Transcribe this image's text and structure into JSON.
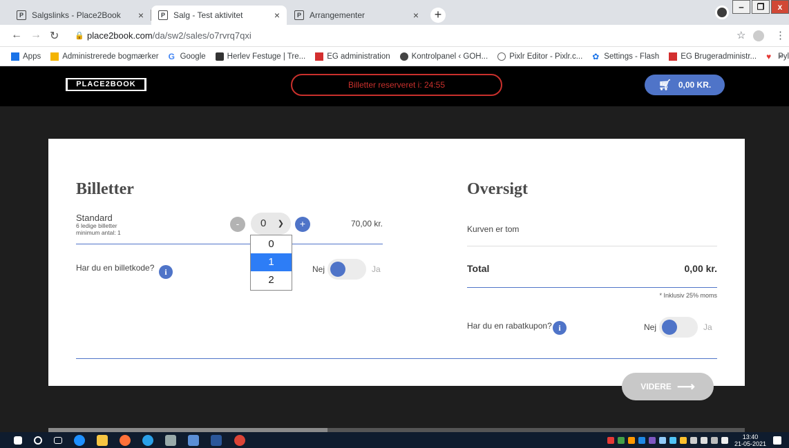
{
  "browser": {
    "tabs": [
      {
        "title": "Salgslinks - Place2Book",
        "active": false
      },
      {
        "title": "Salg - Test aktivitet",
        "active": true
      },
      {
        "title": "Arrangementer",
        "active": false
      }
    ],
    "new_tab": "+",
    "window_controls": {
      "minimize": "‒",
      "restore": "❐",
      "close": "x"
    },
    "url_host": "place2book.com",
    "url_path": "/da/sw2/sales/o7rvrq7qxi",
    "bookmarks": [
      {
        "label": "Apps",
        "icon": "apps-grid-icon",
        "color": "#1a73e8"
      },
      {
        "label": "Administrerede bogmærker",
        "icon": "folder-icon",
        "color": "#f4b400"
      },
      {
        "label": "Google",
        "icon": "google-icon",
        "color": "#4285f4"
      },
      {
        "label": "Herlev Festuge | Tre...",
        "icon": "trello-icon",
        "color": "#333333"
      },
      {
        "label": "EG administration",
        "icon": "eg-icon",
        "color": "#d32f2f"
      },
      {
        "label": "Kontrolpanel ‹ GOH...",
        "icon": "wordpress-icon",
        "color": "#444444"
      },
      {
        "label": "Pixlr Editor - Pixlr.c...",
        "icon": "pixlr-icon",
        "color": "#666666"
      },
      {
        "label": "Settings - Flash",
        "icon": "gear-icon",
        "color": "#1a73e8"
      },
      {
        "label": "EG Brugeradministr...",
        "icon": "eg-icon",
        "color": "#d32f2f"
      },
      {
        "label": "Pylon",
        "icon": "pylon-icon",
        "color": "#e53935"
      }
    ],
    "bookmarks_more": "»"
  },
  "header": {
    "logo": "PLACE2BOOK",
    "timer": "Billetter reserveret i: 24:55",
    "cart": "0,00 KR."
  },
  "tickets": {
    "heading": "Billetter",
    "name": "Standard",
    "available": "6 ledige billetter",
    "minimum": "minimum antal: 1",
    "minus": "-",
    "plus": "+",
    "quantity": "0",
    "price": "70,00 kr.",
    "options": [
      "0",
      "1",
      "2"
    ],
    "highlighted_option": "1",
    "code_label": "Har du en billetkode?",
    "toggle_no": "Nej",
    "toggle_yes": "Ja"
  },
  "overview": {
    "heading": "Oversigt",
    "empty": "Kurven er tom",
    "total_label": "Total",
    "total_value": "0,00 kr.",
    "vat_note": "* Inklusiv 25% moms",
    "coupon_label": "Har du en rabatkupon?",
    "toggle_no": "Nej",
    "toggle_yes": "Ja"
  },
  "next_button": "VIDERE",
  "info_glyph": "i",
  "taskbar": {
    "time": "13:40",
    "date": "21-05-2021"
  },
  "colors": {
    "accent": "#4f74c8",
    "timer_red": "#c9302c",
    "dropdown_highlight": "#2d7df6"
  }
}
